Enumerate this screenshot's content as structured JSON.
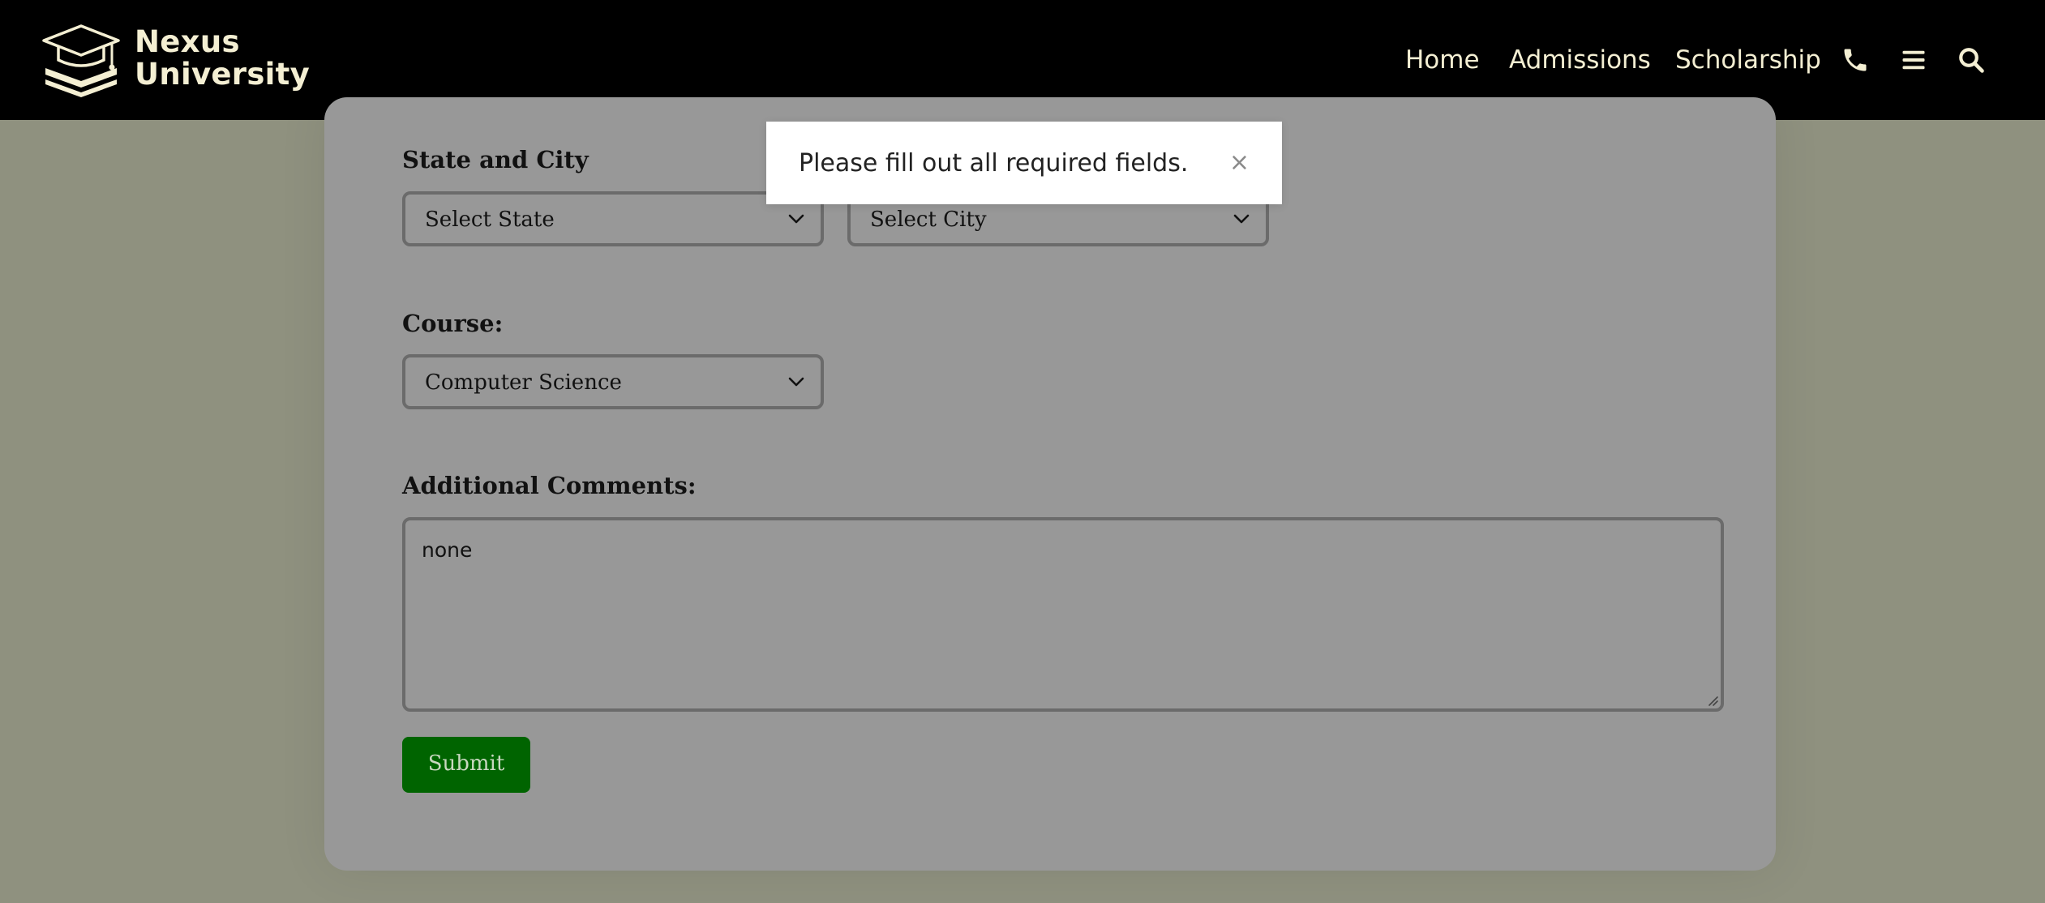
{
  "brand": {
    "name_line1": "Nexus",
    "name_line2": "University",
    "icon": "graduation-cap-books-icon",
    "text_color": "#f4efd3"
  },
  "nav": {
    "links": [
      "Home",
      "Admissions",
      "Scholarship"
    ],
    "icons": [
      "phone-icon",
      "menu-icon",
      "search-icon"
    ],
    "background": "#000000"
  },
  "form": {
    "state_city": {
      "label": "State and City",
      "state_value": "Select State",
      "city_value": "Select City"
    },
    "course": {
      "label": "Course:",
      "value": "Computer Science"
    },
    "comments": {
      "label": "Additional Comments:",
      "value": "none"
    },
    "submit_label": "Submit",
    "submit_color": "#006400"
  },
  "toast": {
    "message": "Please fill out all required fields.",
    "close_symbol": "×"
  }
}
